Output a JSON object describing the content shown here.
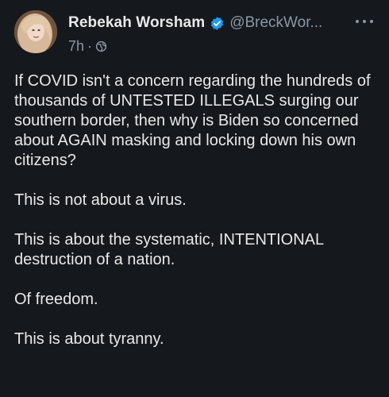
{
  "tweet": {
    "author": {
      "display_name": "Rebekah Worsham",
      "handle": "@BreckWor...",
      "verified": true
    },
    "time": "7h",
    "separator": "·",
    "visibility_icon": "globe-icon",
    "more_icon": "more-options-icon",
    "paragraphs": [
      "If COVID isn't a concern regarding the hundreds of thousands of UNTESTED ILLEGALS surging our southern border, then why is Biden so concerned about AGAIN masking and locking down his own citizens?",
      "This is not about a virus.",
      "This is about the systematic, INTENTIONAL destruction of a nation.",
      "Of freedom.",
      "This is about tyranny."
    ]
  },
  "colors": {
    "background": "#15181c",
    "text": "#e7e9ea",
    "secondary_text": "#8b98a5",
    "verified_badge": "#1d9bf0"
  }
}
